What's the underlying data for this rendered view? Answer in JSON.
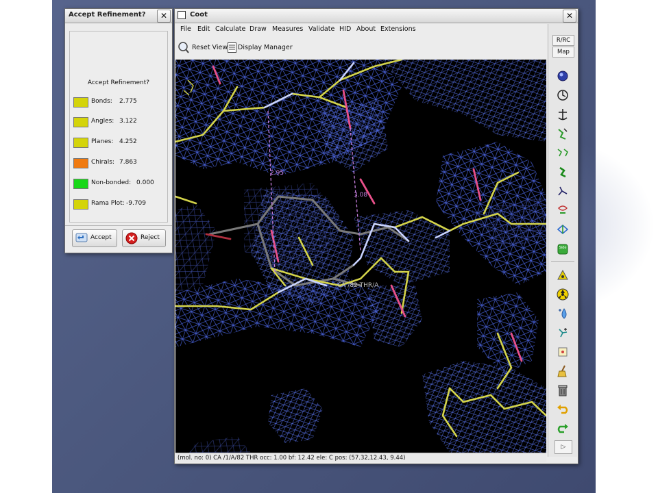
{
  "accept_dialog": {
    "title": "Accept Refinement?",
    "heading": "Accept Refinement?",
    "metrics": [
      {
        "label": "Bonds:",
        "value": "2.775",
        "color": "#d4d40a"
      },
      {
        "label": "Angles:",
        "value": "3.122",
        "color": "#d4d40a"
      },
      {
        "label": "Planes:",
        "value": "4.252",
        "color": "#d4d40a"
      },
      {
        "label": "Chirals:",
        "value": "7.863",
        "color": "#f07a10"
      },
      {
        "label": "Non-bonded:",
        "value": "0.000",
        "color": "#18d818"
      },
      {
        "label": "Rama Plot:",
        "value": "-9.709",
        "color": "#d4d40a"
      }
    ],
    "accept_label": "Accept",
    "reject_label": "Reject"
  },
  "coot": {
    "title": "Coot",
    "menu": [
      "File",
      "Edit",
      "Calculate",
      "Draw",
      "Measures",
      "Validate",
      "HID",
      "About",
      "Extensions"
    ],
    "toolbar": {
      "reset_view": "Reset View",
      "display_manager": "Display Manager"
    },
    "side_tabs": [
      "R/RC",
      "Map"
    ],
    "side_icons": [
      "map-sphere-icon",
      "rotate-icon",
      "anchor-icon",
      "rotate-bond-icon",
      "flip-peptide-icon",
      "add-residue-icon",
      "torsion-icon",
      "mutate-icon",
      "rigid-body-icon",
      "side-chain-icon",
      "add-atom-icon",
      "radiation-icon",
      "water-icon",
      "add-terminal-icon",
      "pointer-atom-icon",
      "clear-icon",
      "delete-icon",
      "undo-icon",
      "redo-icon"
    ],
    "viewport": {
      "distance_1": "2.95",
      "distance_2": "3.08",
      "atom_label": "CA /82 THR/A",
      "map_color": "#4a64e0",
      "carbon_color": "#d4d44a",
      "oxygen_color": "#e8508a",
      "nitrogen_color": "#a8b8ff"
    },
    "status": "(mol. no: 0)  CA /1/A/82 THR occ:  1.00 bf: 12.42 ele:  C pos: (57.32,12.43, 9.44)"
  }
}
